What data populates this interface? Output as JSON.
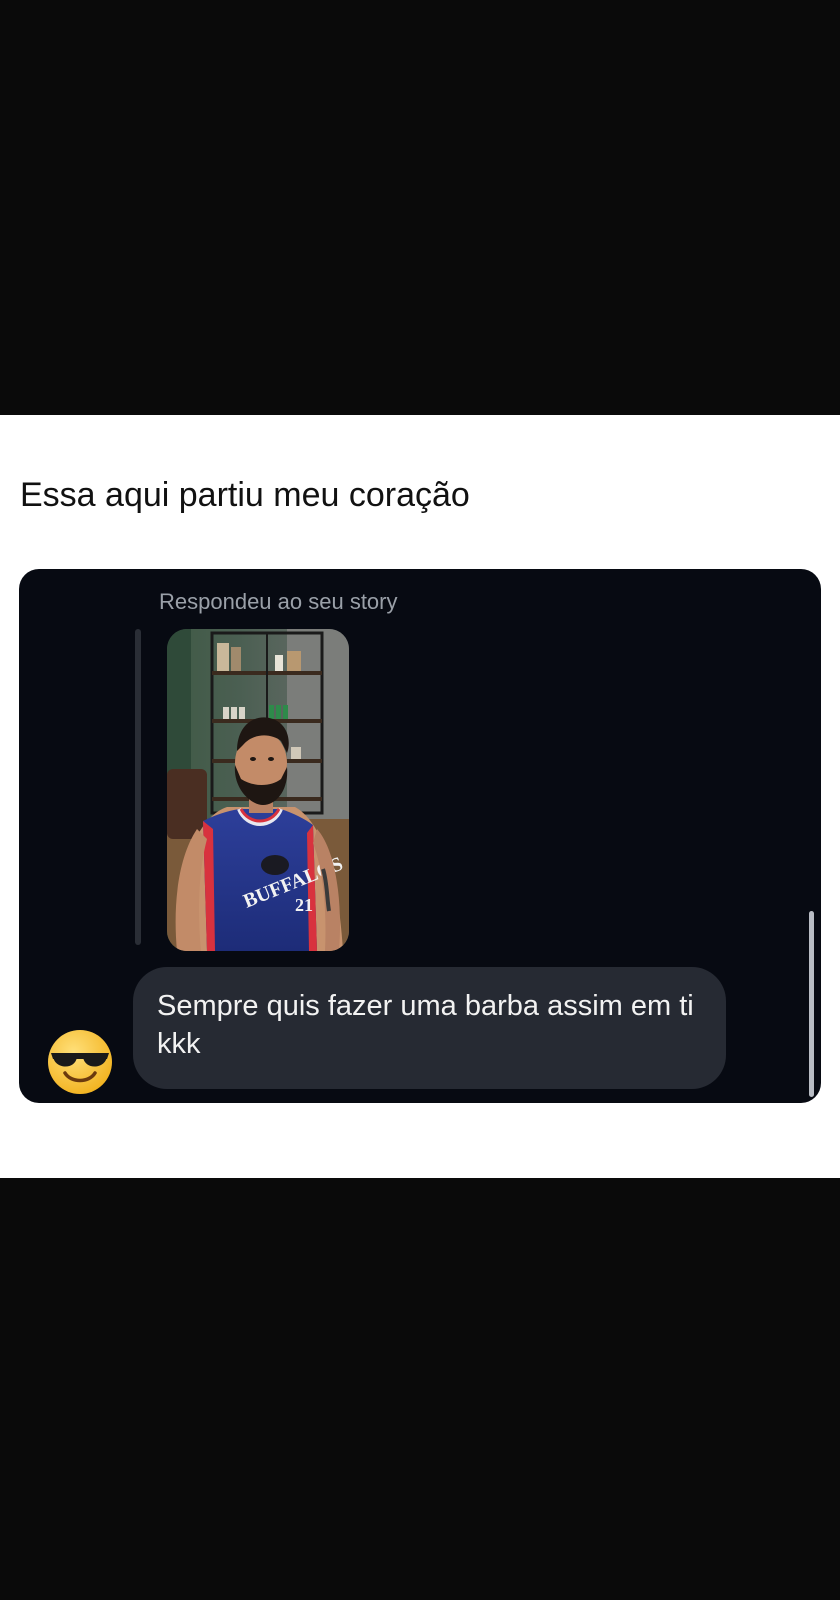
{
  "post": {
    "caption": "Essa aqui partiu meu coração"
  },
  "dm": {
    "reply_label": "Respondeu ao seu story",
    "story": {
      "jersey_text": "BUFFALOS",
      "jersey_number": "21"
    },
    "message": {
      "text": "Sempre quis fazer uma barba assim em ti kkk"
    },
    "sender_avatar_icon": "sunglasses-emoji-icon"
  },
  "colors": {
    "page_background": "#0a0a0a",
    "card_background": "#ffffff",
    "dm_background": "#070a12",
    "bubble_background": "#262a33"
  }
}
